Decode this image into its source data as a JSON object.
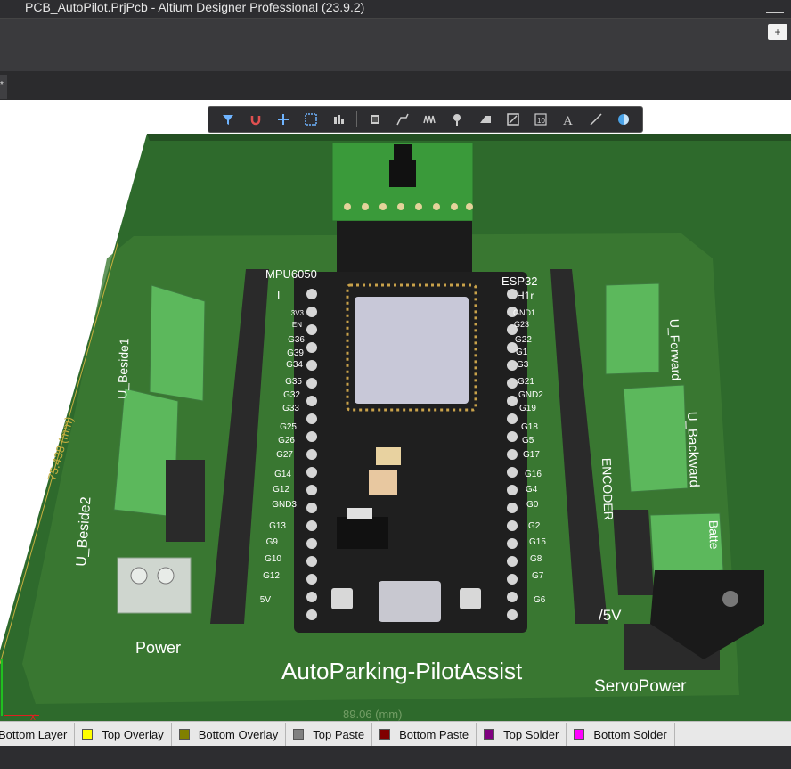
{
  "window": {
    "title": "PCB_AutoPilot.PrjPcb - Altium Designer Professional (23.9.2)"
  },
  "ribbon": {
    "notifications_icon": "message-plus-icon",
    "notifications_glyph": "+"
  },
  "document_tab": {
    "label": "*"
  },
  "toolbar": {
    "tools": [
      {
        "name": "filter-icon"
      },
      {
        "name": "magnet-icon"
      },
      {
        "name": "crosshair-icon"
      },
      {
        "name": "select-rect-icon"
      },
      {
        "name": "align-icon"
      },
      {
        "name": "component-icon"
      },
      {
        "name": "route-icon"
      },
      {
        "name": "interactive-tune-icon"
      },
      {
        "name": "place-via-icon"
      },
      {
        "name": "polygon-pour-icon"
      },
      {
        "name": "keepout-icon"
      },
      {
        "name": "string-icon"
      },
      {
        "name": "text-icon"
      },
      {
        "name": "line-icon"
      },
      {
        "name": "view-3d-icon"
      }
    ],
    "text_glyph": "A"
  },
  "board": {
    "title": "AutoParking-PilotAssist",
    "labels": {
      "mpu": "MPU6050",
      "esp": "ESP32",
      "esp_sub": "H1r",
      "l": "L",
      "u_beside1": "U_Beside1",
      "u_beside2": "U_Beside2",
      "power": "Power",
      "u_forward": "U_Forward",
      "u_backward": "U_Backward",
      "encoder": "ENCODER",
      "battery": "Batte",
      "v5": "5V",
      "five_v_label": "/5V",
      "servo_power": "ServoPower",
      "dim_left": "75.438 (mm)",
      "dim_bottom": "89.06 (mm)"
    },
    "left_pins": [
      "3V3",
      "EN",
      "G36",
      "G39",
      "G34",
      "G35",
      "G32",
      "G33",
      "G25",
      "G26",
      "G27",
      "G14",
      "G12",
      "GND3",
      "G13",
      "G9",
      "G10",
      "G12",
      "5V"
    ],
    "right_pins": [
      "GND1",
      "G23",
      "G22",
      "G1",
      "G3",
      "G21",
      "GND2",
      "G19",
      "G18",
      "G5",
      "G17",
      "G16",
      "G4",
      "G0",
      "G2",
      "G15",
      "G8",
      "G7",
      "G6"
    ]
  },
  "layers": [
    {
      "label": "Bottom Layer",
      "color": "#2f5bd8"
    },
    {
      "label": "Top Overlay",
      "color": "#ffff00"
    },
    {
      "label": "Bottom Overlay",
      "color": "#808000"
    },
    {
      "label": "Top Paste",
      "color": "#808080"
    },
    {
      "label": "Bottom Paste",
      "color": "#800000"
    },
    {
      "label": "Top Solder",
      "color": "#800080"
    },
    {
      "label": "Bottom Solder",
      "color": "#ff00ff"
    }
  ]
}
